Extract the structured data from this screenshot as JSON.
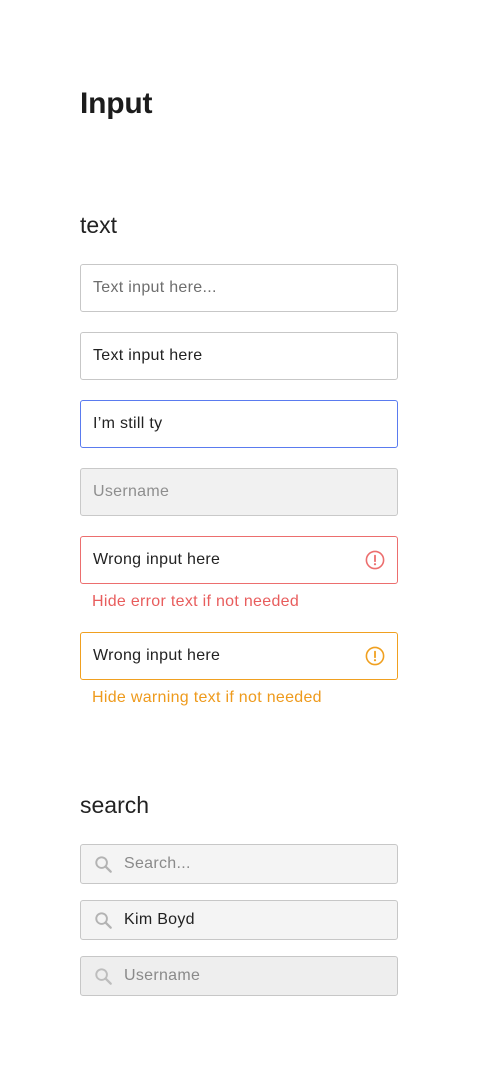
{
  "page": {
    "title": "Input"
  },
  "text_section": {
    "title": "text",
    "fields": [
      {
        "state": "default",
        "value": "",
        "placeholder": "Text input here..."
      },
      {
        "state": "filled",
        "value": "Text input here",
        "placeholder": ""
      },
      {
        "state": "focused",
        "value": "I’m still ty",
        "placeholder": ""
      },
      {
        "state": "disabled",
        "value": "",
        "placeholder": "Username"
      },
      {
        "state": "error",
        "value": "Wrong input here",
        "placeholder": "",
        "icon": "alert-circle-icon",
        "helper": "Hide error text if not needed"
      },
      {
        "state": "warning",
        "value": "Wrong input here",
        "placeholder": "",
        "icon": "alert-circle-icon",
        "helper": "Hide warning text if not needed"
      }
    ]
  },
  "search_section": {
    "title": "search",
    "fields": [
      {
        "state": "default",
        "value": "",
        "placeholder": "Search...",
        "icon": "search-icon"
      },
      {
        "state": "filled",
        "value": "Kim Boyd",
        "placeholder": "",
        "icon": "search-icon"
      },
      {
        "state": "disabled",
        "value": "",
        "placeholder": "Username",
        "icon": "search-icon"
      }
    ]
  },
  "colors": {
    "border": "#c7c7c7",
    "focus": "#5a7bef",
    "error": "#ec6e6e",
    "warning": "#f0a020",
    "disabled_bg": "#f1f1f1"
  }
}
